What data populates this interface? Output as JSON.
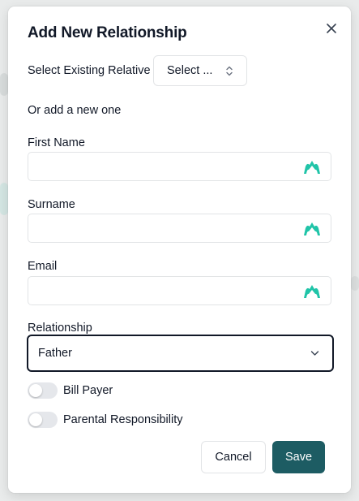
{
  "modal": {
    "title": "Add New Relationship",
    "close_icon": "close-icon"
  },
  "existing_relative": {
    "label": "Select Existing Relative",
    "value": "Select ..."
  },
  "new_section_label": "Or add a new one",
  "fields": {
    "first_name": {
      "label": "First Name",
      "value": ""
    },
    "surname": {
      "label": "Surname",
      "value": ""
    },
    "email": {
      "label": "Email",
      "value": ""
    }
  },
  "field_icon": "teal-crown-icon",
  "relationship": {
    "label": "Relationship",
    "value": "Father"
  },
  "toggles": {
    "bill_payer": {
      "label": "Bill Payer",
      "on": false
    },
    "parental_responsibility": {
      "label": "Parental Responsibility",
      "on": false
    }
  },
  "buttons": {
    "cancel": "Cancel",
    "save": "Save"
  },
  "colors": {
    "accent": "#1d5c63",
    "field_icon": "#20c4a8",
    "focus_border": "#111827"
  }
}
